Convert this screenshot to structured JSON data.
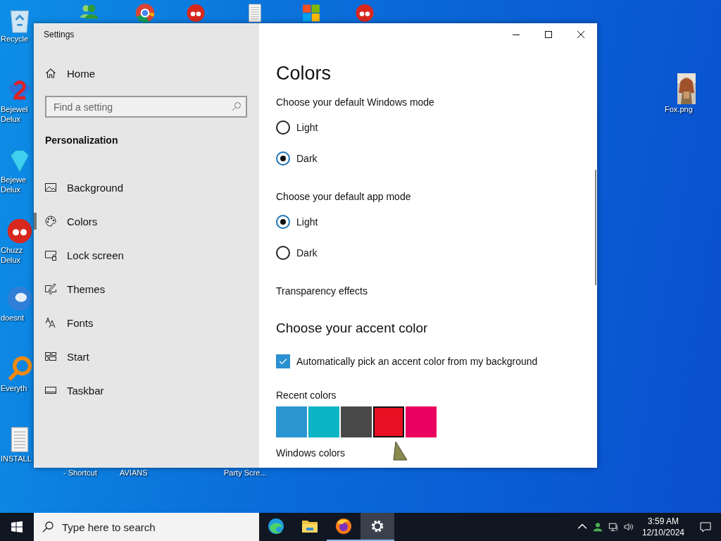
{
  "desktop": {
    "icons": [
      {
        "kind": "bin",
        "lines": [
          "Recycle"
        ]
      },
      {
        "kind": "people"
      },
      {
        "kind": "browser"
      },
      {
        "kind": "ball"
      },
      {
        "kind": "document"
      },
      {
        "kind": "blocks"
      },
      {
        "kind": "ball"
      },
      {
        "kind": "game",
        "lines": [
          "Bejewel",
          "Delux"
        ]
      },
      {
        "kind": "gem",
        "lines": [
          "Bejewe",
          "Delux"
        ]
      },
      {
        "kind": "ball",
        "lines": [
          "Chuzz",
          "Delux"
        ]
      },
      {
        "kind": "globe",
        "lines": [
          "doesnt"
        ]
      },
      {
        "kind": "search",
        "lines": [
          "Everyth"
        ]
      },
      {
        "kind": "document",
        "lines": [
          "INSTALL"
        ]
      },
      {
        "kind": "none",
        "lines": [
          "- Shortcut"
        ]
      },
      {
        "kind": "none",
        "lines": [
          "AVIANS"
        ]
      },
      {
        "kind": "none",
        "lines": [
          "Party Scre..."
        ]
      },
      {
        "lines": [
          "Fox.png"
        ]
      }
    ]
  },
  "window": {
    "title": "Settings"
  },
  "sidebar": {
    "home": "Home",
    "search": {
      "placeholder": "Find a setting"
    },
    "section": "Personalization",
    "items": [
      {
        "label": "Background",
        "selected": false
      },
      {
        "label": "Colors",
        "kind": "palette",
        "selected": true
      },
      {
        "label": "Lock screen",
        "kind": "lock",
        "selected": false
      },
      {
        "label": "Themes",
        "kind": "themes",
        "selected": false
      },
      {
        "label": "Fonts",
        "kind": "fonts",
        "selected": false
      },
      {
        "label": "Start",
        "kind": "start",
        "selected": false
      },
      {
        "label": "Taskbar",
        "kind": "taskbar",
        "selected": false
      }
    ]
  },
  "content": {
    "title": "Colors",
    "modes": [
      {
        "label": "Choose your default Windows mode",
        "options": [
          {
            "label": "Light",
            "selected": false
          },
          {
            "label": "Dark",
            "selected": true
          }
        ]
      },
      {
        "label": "Choose your default app mode",
        "options": [
          {
            "label": "Light",
            "selected": true
          },
          {
            "label": "Dark",
            "selected": false
          }
        ]
      }
    ],
    "transparency_label": "Transparency effects",
    "accent": {
      "title": "Choose your accent color",
      "auto_pick": {
        "label": "Automatically pick an accent color from my background",
        "checked": true
      },
      "recent_label": "Recent colors",
      "recent_colors": [
        {
          "color": "#2b95d1",
          "selected": false
        },
        {
          "color": "#0cb4c4",
          "selected": false
        },
        {
          "color": "#484848",
          "selected": false
        },
        {
          "color": "#e81123",
          "selected": true
        },
        {
          "color": "#ea005e",
          "selected": false
        }
      ],
      "windows_colors_label": "Windows colors"
    }
  },
  "taskbar": {
    "search": {
      "placeholder": "Type here to search"
    },
    "apps": [
      {
        "kind": "edge",
        "running": false,
        "active": false
      },
      {
        "kind": "folder",
        "running": false,
        "active": false
      },
      {
        "kind": "firefox",
        "running": true,
        "active": false
      },
      {
        "kind": "settings",
        "running": true,
        "active": true
      }
    ],
    "clock": {
      "time": "3:59 AM",
      "date": "12/10/2024"
    }
  }
}
